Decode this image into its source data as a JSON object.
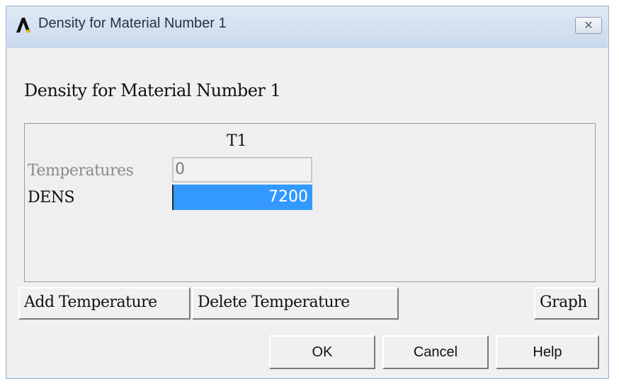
{
  "window": {
    "title": "Density for Material Number 1",
    "close_glyph": "✕"
  },
  "dialog": {
    "heading": "Density for Material Number 1",
    "table": {
      "column_header": "T1",
      "rows": [
        {
          "label": "Temperatures",
          "value": "0",
          "enabled": false
        },
        {
          "label": "DENS",
          "value": "7200",
          "enabled": true,
          "selected": true
        }
      ]
    },
    "actions": {
      "add_temperature": "Add Temperature",
      "delete_temperature": "Delete Temperature",
      "graph": "Graph"
    },
    "buttons": {
      "ok": "OK",
      "cancel": "Cancel",
      "help": "Help"
    }
  },
  "colors": {
    "selection": "#3399ff",
    "titlebar": "#c9d9ec",
    "background": "#f0f0f0"
  },
  "icons": {
    "app": "ansys-logo-icon",
    "close": "close-icon"
  }
}
